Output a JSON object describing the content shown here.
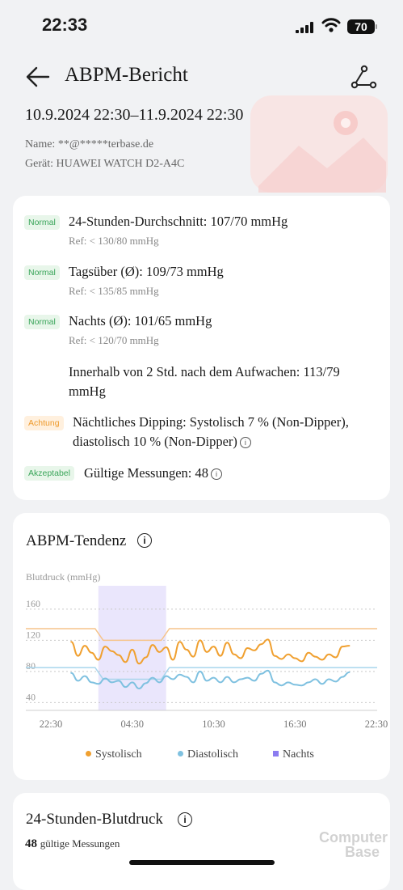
{
  "status": {
    "time": "22:33",
    "battery": "70"
  },
  "header": {
    "title": "ABPM-Bericht",
    "back_icon": "back-arrow-icon",
    "share_icon": "share-icon"
  },
  "report": {
    "range": "10.9.2024 22:30–11.9.2024 22:30",
    "name_label": "Name: **@*****terbase.de",
    "device_label": "Gerät: HUAWEI WATCH D2-A4C"
  },
  "summary": {
    "avg": {
      "badge": "Normal",
      "text": "24-Stunden-Durchschnitt: 107/70 mmHg",
      "ref": "Ref: < 130/80 mmHg"
    },
    "day": {
      "badge": "Normal",
      "text": "Tagsüber (Ø): 109/73 mmHg",
      "ref": "Ref: < 135/85 mmHg"
    },
    "night": {
      "badge": "Normal",
      "text": "Nachts (Ø): 101/65 mmHg",
      "ref": "Ref: < 120/70 mmHg"
    },
    "wake_line1": "Innerhalb von 2 Std. nach dem Aufwachen: 113/79",
    "wake_line2": "mmHg",
    "dipping": {
      "badge": "Achtung",
      "line1": "Nächtliches Dipping: Systolisch 7 % (Non-Dipper),",
      "line2": "diastolisch 10 % (Non-Dipper)"
    },
    "valid": {
      "badge": "Akzeptabel",
      "text": "Gültige Messungen: 48"
    }
  },
  "trend": {
    "title": "ABPM-Tendenz"
  },
  "chart_data": {
    "type": "line",
    "ylabel": "Blutdruck (mmHg)",
    "yticks": [
      "160",
      "120",
      "80",
      "40"
    ],
    "ylim": [
      30,
      190
    ],
    "xticks": [
      "22:30",
      "04:30",
      "10:30",
      "16:30",
      "22:30"
    ],
    "xlim": [
      0,
      24
    ],
    "grid": true,
    "night_band": [
      3.5,
      8.5
    ],
    "ref_lines": [
      {
        "color": "#f6c48a",
        "day": 135,
        "night": 120
      },
      {
        "color": "#a8d5ec",
        "day": 85,
        "night": 70
      }
    ],
    "series": [
      {
        "name": "Systolisch",
        "color": "#f0a030",
        "x": [
          1.5,
          2,
          2.5,
          3,
          3.5,
          4,
          4.5,
          5,
          5.5,
          6,
          6.5,
          7,
          7.5,
          8,
          8.5,
          9,
          9.5,
          10,
          10.5,
          11,
          11.5,
          12,
          12.5,
          13,
          13.5,
          14,
          14.5,
          15,
          15.5,
          16,
          16.5,
          17,
          17.5,
          18,
          18.5,
          19,
          19.5,
          20,
          20.5,
          21,
          21.5,
          22
        ],
        "y": [
          118,
          100,
          113,
          104,
          95,
          112,
          106,
          101,
          92,
          108,
          90,
          98,
          114,
          105,
          111,
          95,
          118,
          108,
          99,
          120,
          105,
          112,
          100,
          117,
          102,
          97,
          110,
          107,
          115,
          121,
          100,
          96,
          102,
          97,
          93,
          104,
          99,
          95,
          102,
          98,
          112,
          113
        ]
      },
      {
        "name": "Diastolisch",
        "color": "#7fc1e0",
        "x": [
          1.5,
          2,
          2.5,
          3,
          3.5,
          4,
          4.5,
          5,
          5.5,
          6,
          6.5,
          7,
          7.5,
          8,
          8.5,
          9,
          9.5,
          10,
          10.5,
          11,
          11.5,
          12,
          12.5,
          13,
          13.5,
          14,
          14.5,
          15,
          15.5,
          16,
          16.5,
          17,
          17.5,
          18,
          18.5,
          19,
          19.5,
          20,
          20.5,
          21,
          21.5,
          22
        ],
        "y": [
          78,
          68,
          74,
          66,
          64,
          71,
          66,
          68,
          60,
          66,
          58,
          65,
          72,
          66,
          74,
          70,
          76,
          73,
          66,
          80,
          68,
          72,
          66,
          73,
          66,
          70,
          72,
          68,
          77,
          81,
          66,
          62,
          66,
          63,
          62,
          66,
          70,
          64,
          70,
          67,
          73,
          79
        ]
      }
    ],
    "legend": [
      "Systolisch",
      "Diastolisch",
      "Nachts"
    ],
    "legend_colors": [
      "#f0a030",
      "#7fc1e0",
      "#8b7cf0"
    ]
  },
  "bp24": {
    "title": "24-Stunden-Blutdruck",
    "count": "48",
    "count_label": "gültige Messungen"
  },
  "watermark": {
    "line1": "Computer",
    "line2": "Base"
  }
}
